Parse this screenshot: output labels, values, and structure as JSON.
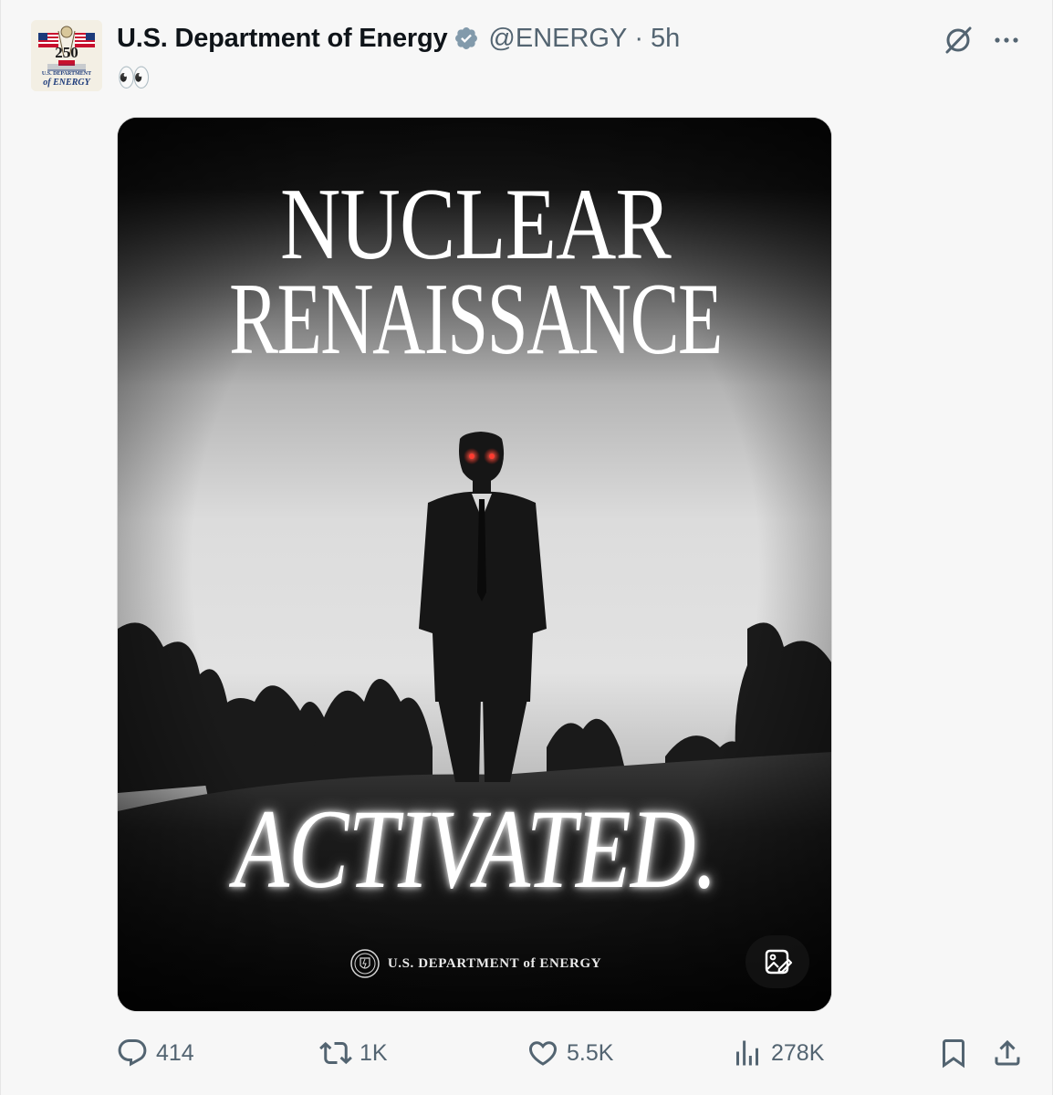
{
  "tweet": {
    "display_name": "U.S. Department of Energy",
    "handle": "@ENERGY",
    "separator": "·",
    "time": "5h",
    "text": "👀",
    "verified_badge_color": "#829aab"
  },
  "avatar": {
    "badge_number": "250",
    "caption_line1": "U.S. DEPARTMENT",
    "caption_line2": "of ENERGY"
  },
  "media": {
    "headline_line1": "NUCLEAR",
    "headline_line2": "RENAISSANCE",
    "tagline": "ACTIVATED.",
    "footer": "U.S. DEPARTMENT of ENERGY",
    "eye_color": "#ff3b30"
  },
  "actions": {
    "replies": "414",
    "reposts": "1K",
    "likes": "5.5K",
    "views": "278K"
  },
  "icons": {
    "reply": "reply-icon",
    "repost": "repost-icon",
    "like": "heart-icon",
    "views": "views-chart-icon",
    "bookmark": "bookmark-icon",
    "share": "share-icon",
    "grok": "grok-icon",
    "more": "more-icon",
    "media_edit": "image-edit-icon"
  }
}
